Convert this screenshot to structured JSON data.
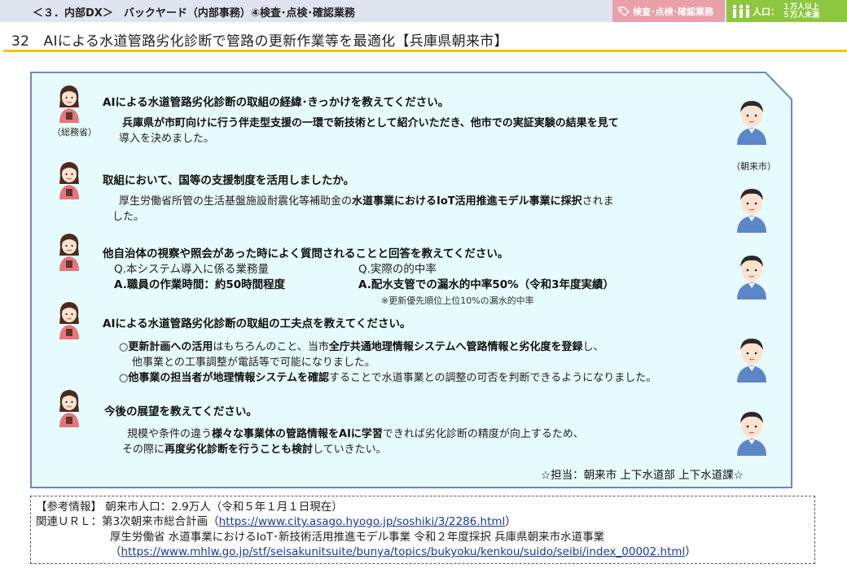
{
  "header": {
    "breadcrumb": "＜３．内部DX＞　バックヤード（内部事務）④検査･点検･確認業務",
    "category_tag": "検査･点検･確認業務",
    "population_label": "人口：",
    "population_range": [
      "１万人以上",
      "５万人未満"
    ],
    "category_color": "#e9a0a8",
    "population_color": "#8dc63f"
  },
  "title": "32　AIによる水道管路劣化診断で管路の更新作業等を最適化【兵庫県朝来市】",
  "speakers": {
    "interviewer_label": "（総務省）",
    "respondent_label": "（朝来市）"
  },
  "qa": {
    "q1": "AIによる水道管路劣化診断の取組の経緯･きっかけを教えてください。",
    "a1_line1": "兵庫県が市町向けに行う伴走型支援の一環で新技術として紹介いただき、他市での実証実験の結果を見て",
    "a1_line2": "導入を決めました。",
    "q2": "取組において、国等の支援制度を活用しましたか。",
    "a2_pre": "厚生労働省所管の生活基盤施設耐震化等補助金の",
    "a2_bold": "水道事業におけるIoT活用推進モデル事業に採択",
    "a2_post": "されま",
    "a2_line2": "した。",
    "q3": "他自治体の視察や照会があった時によく質問されることと回答を教えてください。",
    "q3_item1_q": "Q.本システム導入に係る業務量",
    "q3_item1_a": "A.職員の作業時間：約50時間程度",
    "q3_item2_q": "Q.実際の的中率",
    "q3_item2_a": "A.配水支管での漏水的中率50%（令和3年度実績）",
    "q3_note": "※更新優先順位上位10%の漏水的中率",
    "q4": "AIによる水道管路劣化診断の取組の工夫点を教えてください。",
    "a4_l1_b1": "○更新計画への活用",
    "a4_l1_t1": "はもちろんのこと、当市",
    "a4_l1_b2": "全庁共通地理情報システムへ管路情報と劣化度を登録",
    "a4_l1_t2": "し、",
    "a4_l2": "他事業との工事調整が電話等で可能になりました。",
    "a4_l3_b1": "○他事業の担当者が地理情報システムを確認",
    "a4_l3_t1": "することで水道事業との調整の可否を判断できるようになりました。",
    "q5": "今後の展望を教えてください。",
    "a5_l1_t1": "規模や条件の違う",
    "a5_l1_b1": "様々な事業体の管路情報をAIに学習",
    "a5_l1_t2": "できれば劣化診断の精度が向上するため、",
    "a5_l2_t1": "その際に",
    "a5_l2_b1": "再度劣化診断を行うことも検討",
    "a5_l2_t2": "していきたい。",
    "contact": "☆担当：朝来市 上下水道部 上下水道課☆"
  },
  "reference": {
    "l1": "【参考情報】 朝来市人口：2.9万人（令和５年１月１日現在）",
    "l2_pre": "関連ＵＲＬ：第3次朝来市総合計画（",
    "l2_url": "https://www.city.asago.hyogo.jp/soshiki/3/2286.html",
    "l2_post": "）",
    "l3": "厚生労働省 水道事業におけるIoT･新技術活用推進モデル事業 令和２年度採択 兵庫県朝来市水道事業",
    "l4_pre": "（",
    "l4_url": "https://www.mhlw.go.jp/stf/seisakunitsuite/bunya/topics/bukyoku/kenkou/suido/seibi/index_00002.html",
    "l4_post": "）"
  },
  "colors": {
    "card_fill": "#e6fbfb",
    "card_border": "#6f86c4",
    "title_rule": "#f5c400"
  }
}
